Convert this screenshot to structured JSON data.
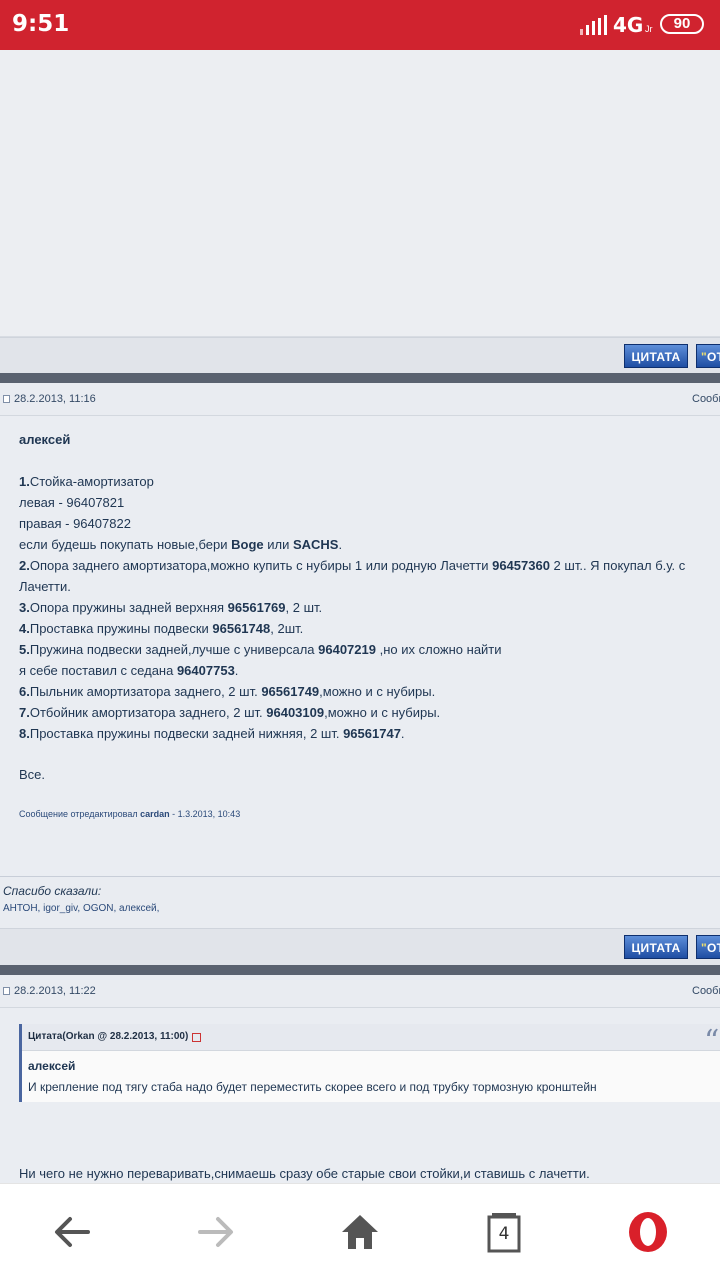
{
  "statusbar": {
    "time": "9:51",
    "network": "4G",
    "network_sub": "Jr",
    "battery": "90"
  },
  "toolbar": {
    "quote_label": "ЦИТАТА",
    "reply_label": "OT"
  },
  "post1": {
    "date": "28.2.2013, 11:16",
    "msg_label": "Сообщ",
    "author": "алексей",
    "lines": {
      "l1_num": "1.",
      "l1_text": "Стойка-амортизатор",
      "l2": "левая - 96407821",
      "l3": "правая - 96407822",
      "l4_a": "если будешь покупать новые,бери ",
      "l4_b": "Boge",
      "l4_c": " или ",
      "l4_d": "SACHS",
      "l4_e": ".",
      "l5_num": "2.",
      "l5_a": "Опора заднего амортизатора,можно купить с нубиры 1 или родную Лачетти ",
      "l5_b": "96457360",
      "l5_c": " 2 шт.. Я покупал б.у. с",
      "l6": "Лачетти.",
      "l7_num": "3.",
      "l7_a": "Опора пружины задней верхняя ",
      "l7_b": "96561769",
      "l7_c": ", 2 шт.",
      "l8_num": "4.",
      "l8_a": "Проставка пружины подвески ",
      "l8_b": "96561748",
      "l8_c": ", 2шт.",
      "l9_num": "5.",
      "l9_a": "Пружина подвески задней,лучше с универсала ",
      "l9_b": "96407219",
      "l9_c": " ,но их сложно найти",
      "l10_a": "я себе поставил с седана ",
      "l10_b": "96407753",
      "l10_c": ".",
      "l11_num": "6.",
      "l11_a": "Пыльник амортизатора заднего, 2 шт. ",
      "l11_b": "96561749",
      "l11_c": ",можно и с нубиры.",
      "l12_num": "7.",
      "l12_a": "Отбойник амортизатора заднего, 2 шт. ",
      "l12_b": "96403109",
      "l12_c": ",можно и с нубиры.",
      "l13_num": "8.",
      "l13_a": "Проставка пружины подвески задней нижняя, 2 шт. ",
      "l13_b": "96561747",
      "l13_c": ".",
      "l14": "Все."
    },
    "edited_prefix": "Сообщение отредактировал ",
    "edited_user": "cardan",
    "edited_suffix": " - 1.3.2013, 10:43"
  },
  "thanks": {
    "label": "Спасибо сказали:",
    "users": "АНТОН, igor_giv, OGON, алексей,"
  },
  "post2": {
    "date": "28.2.2013, 11:22",
    "msg_label": "Сообщ",
    "quote_title": "Цитата(Orkan @ 28.2.2013, 11:00)",
    "quote_author": "алексей",
    "quote_text": "И крепление под тягу стаба надо будет переместить скорее всего и под трубку тормозную кронштейн",
    "body": "Ни чего не нужно переваривать,снимаешь сразу обе старые свои стойки,и ставишь с лачетти."
  },
  "nav": {
    "tabs_count": "4"
  }
}
